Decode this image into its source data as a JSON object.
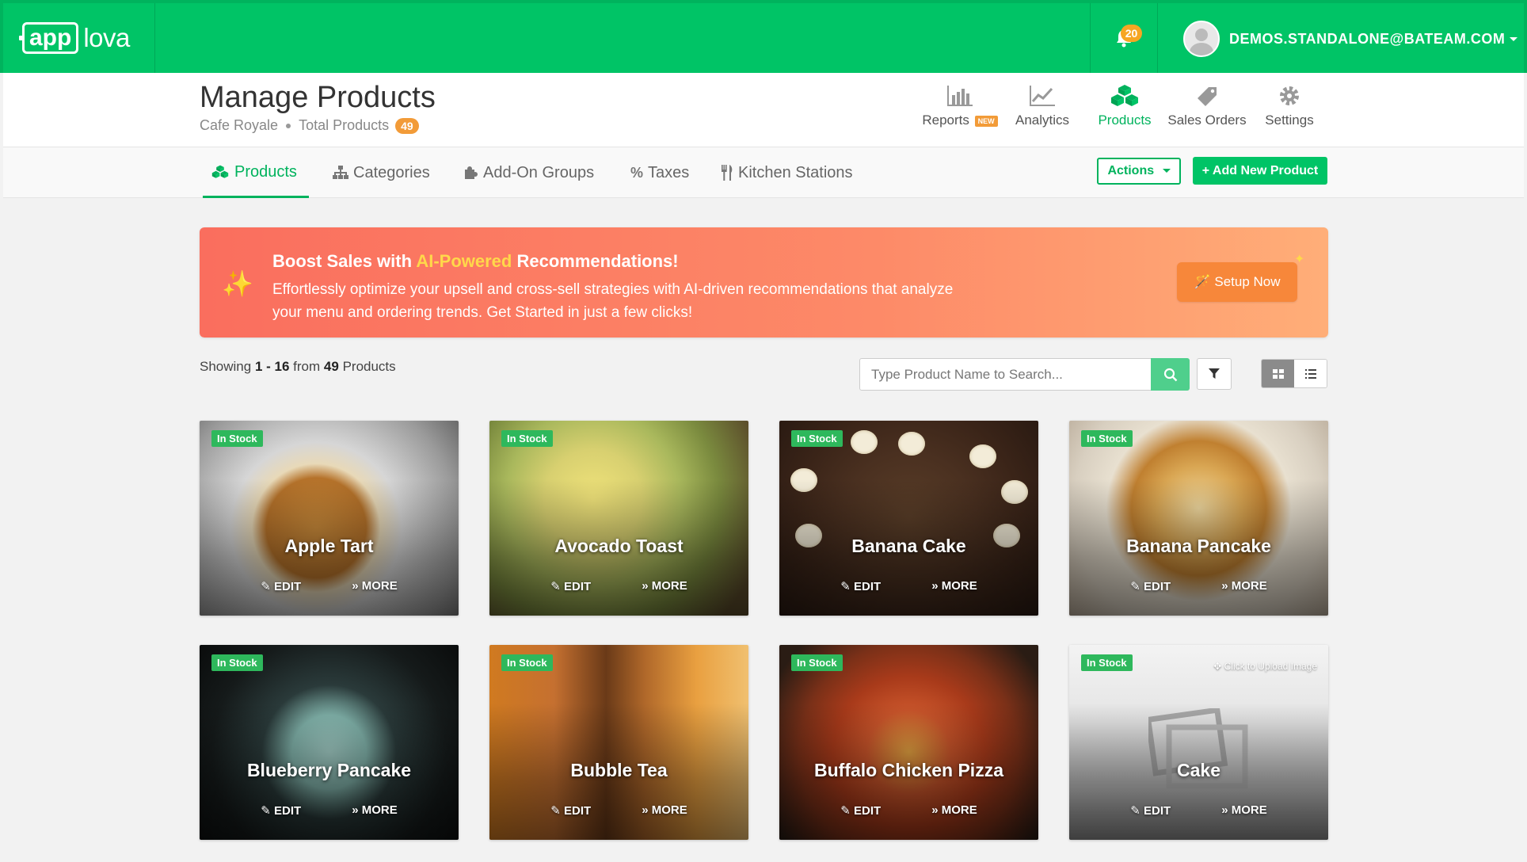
{
  "brand": {
    "logo_box": "app",
    "logo_rest": "lova"
  },
  "topbar": {
    "notification_count": "20",
    "user_email": "DEMOS.STANDALONE@BATEAM.COM"
  },
  "header": {
    "title": "Manage Products",
    "store": "Cafe Royale",
    "total_label": "Total Products",
    "total_count": "49",
    "modules": [
      {
        "label": "Reports",
        "badge": "NEW",
        "icon": "bar-chart-icon"
      },
      {
        "label": "Analytics",
        "icon": "line-chart-icon"
      },
      {
        "label": "Products",
        "icon": "cubes-icon",
        "active": true
      },
      {
        "label": "Sales Orders",
        "icon": "tag-icon"
      },
      {
        "label": "Settings",
        "icon": "gear-icon"
      }
    ]
  },
  "tabs": [
    {
      "label": "Products",
      "icon": "cubes-icon",
      "active": true
    },
    {
      "label": "Categories",
      "icon": "sitemap-icon"
    },
    {
      "label": "Add-On Groups",
      "icon": "puzzle-icon"
    },
    {
      "label": "Taxes",
      "icon": "percent-icon"
    },
    {
      "label": "Kitchen Stations",
      "icon": "cutlery-icon"
    }
  ],
  "toolbar": {
    "actions_label": "Actions",
    "add_label": "Add New Product"
  },
  "banner": {
    "title_pre": "Boost Sales with ",
    "title_highlight": "AI-Powered",
    "title_post": " Recommendations!",
    "text": "Effortlessly optimize your upsell and cross-sell strategies with AI-driven recommendations that analyze your menu and ordering trends. Get Started in just a few clicks!",
    "button": "Setup Now"
  },
  "listing": {
    "showing_pre": "Showing",
    "range": "1 - 16",
    "from": "from",
    "total": "49",
    "unit": "Products",
    "search_placeholder": "Type Product Name to Search..."
  },
  "card_labels": {
    "stock": "In Stock",
    "edit": "EDIT",
    "more": "MORE",
    "upload": "Click to Upload Image"
  },
  "products": [
    {
      "name": "Apple Tart"
    },
    {
      "name": "Avocado Toast"
    },
    {
      "name": "Banana Cake"
    },
    {
      "name": "Banana Pancake"
    },
    {
      "name": "Blueberry Pancake"
    },
    {
      "name": "Bubble Tea"
    },
    {
      "name": "Buffalo Chicken Pizza"
    },
    {
      "name": "Cake"
    }
  ],
  "colors": {
    "brand_green": "#00c466",
    "accent_orange": "#f7873a",
    "stock_green": "#2eb85c"
  }
}
